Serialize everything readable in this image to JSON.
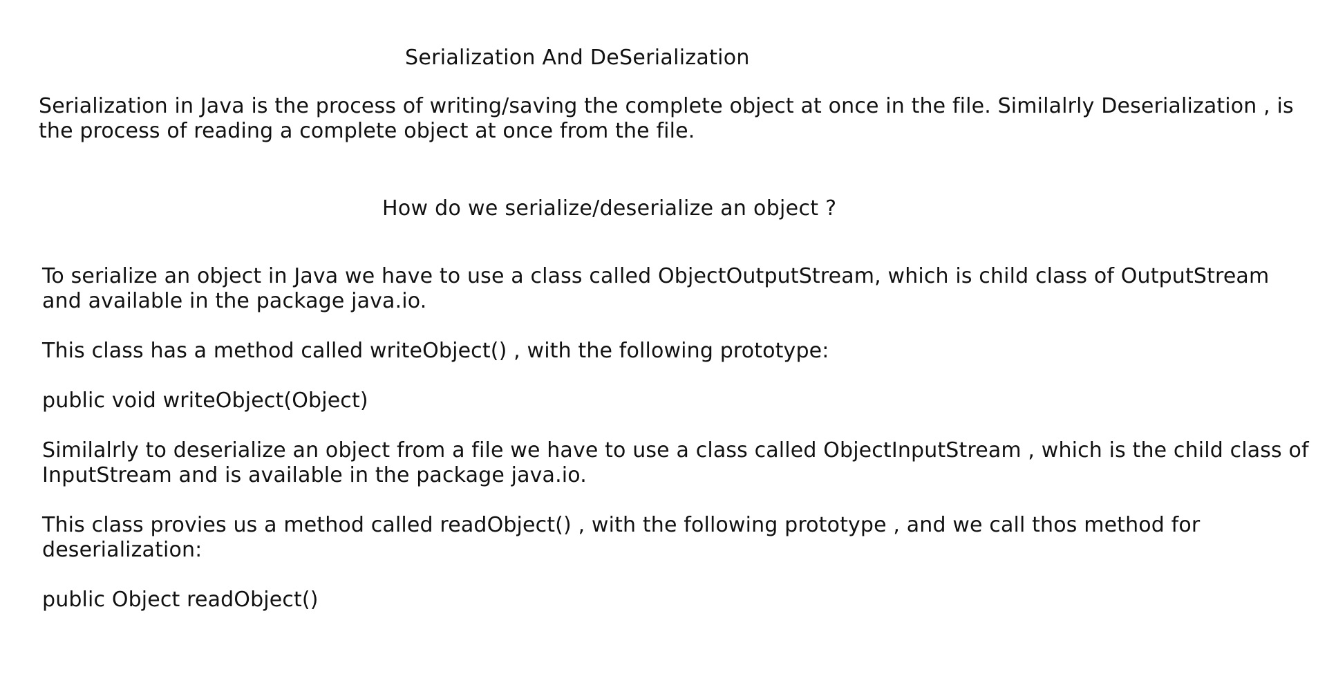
{
  "document": {
    "title": "Serialization And DeSerialization",
    "intro": [
      "Serialization in Java is the process of writing/saving the complete object at once in the file. Similalrly Deserialization , is",
      "the process of reading a complete object at once from the file."
    ],
    "subtitle": "How do we serialize/deserialize an object ?",
    "paragraphs": [
      [
        "To serialize an object in Java we have to use a class called ObjectOutputStream, which is child class of OutputStream",
        "and available in the package java.io."
      ],
      [
        "This class has a method called writeObject() , with the following prototype:"
      ],
      [
        "public void writeObject(Object)"
      ],
      [
        "Similalrly to deserialize an object from a file we have to use a class called ObjectInputStream , which is the child class of",
        "InputStream and is available in the package java.io."
      ],
      [
        "This class provies us a method called readObject() , with the following prototype , and we call thos method for",
        "deserialization:"
      ],
      [
        "public Object readObject()"
      ]
    ]
  }
}
